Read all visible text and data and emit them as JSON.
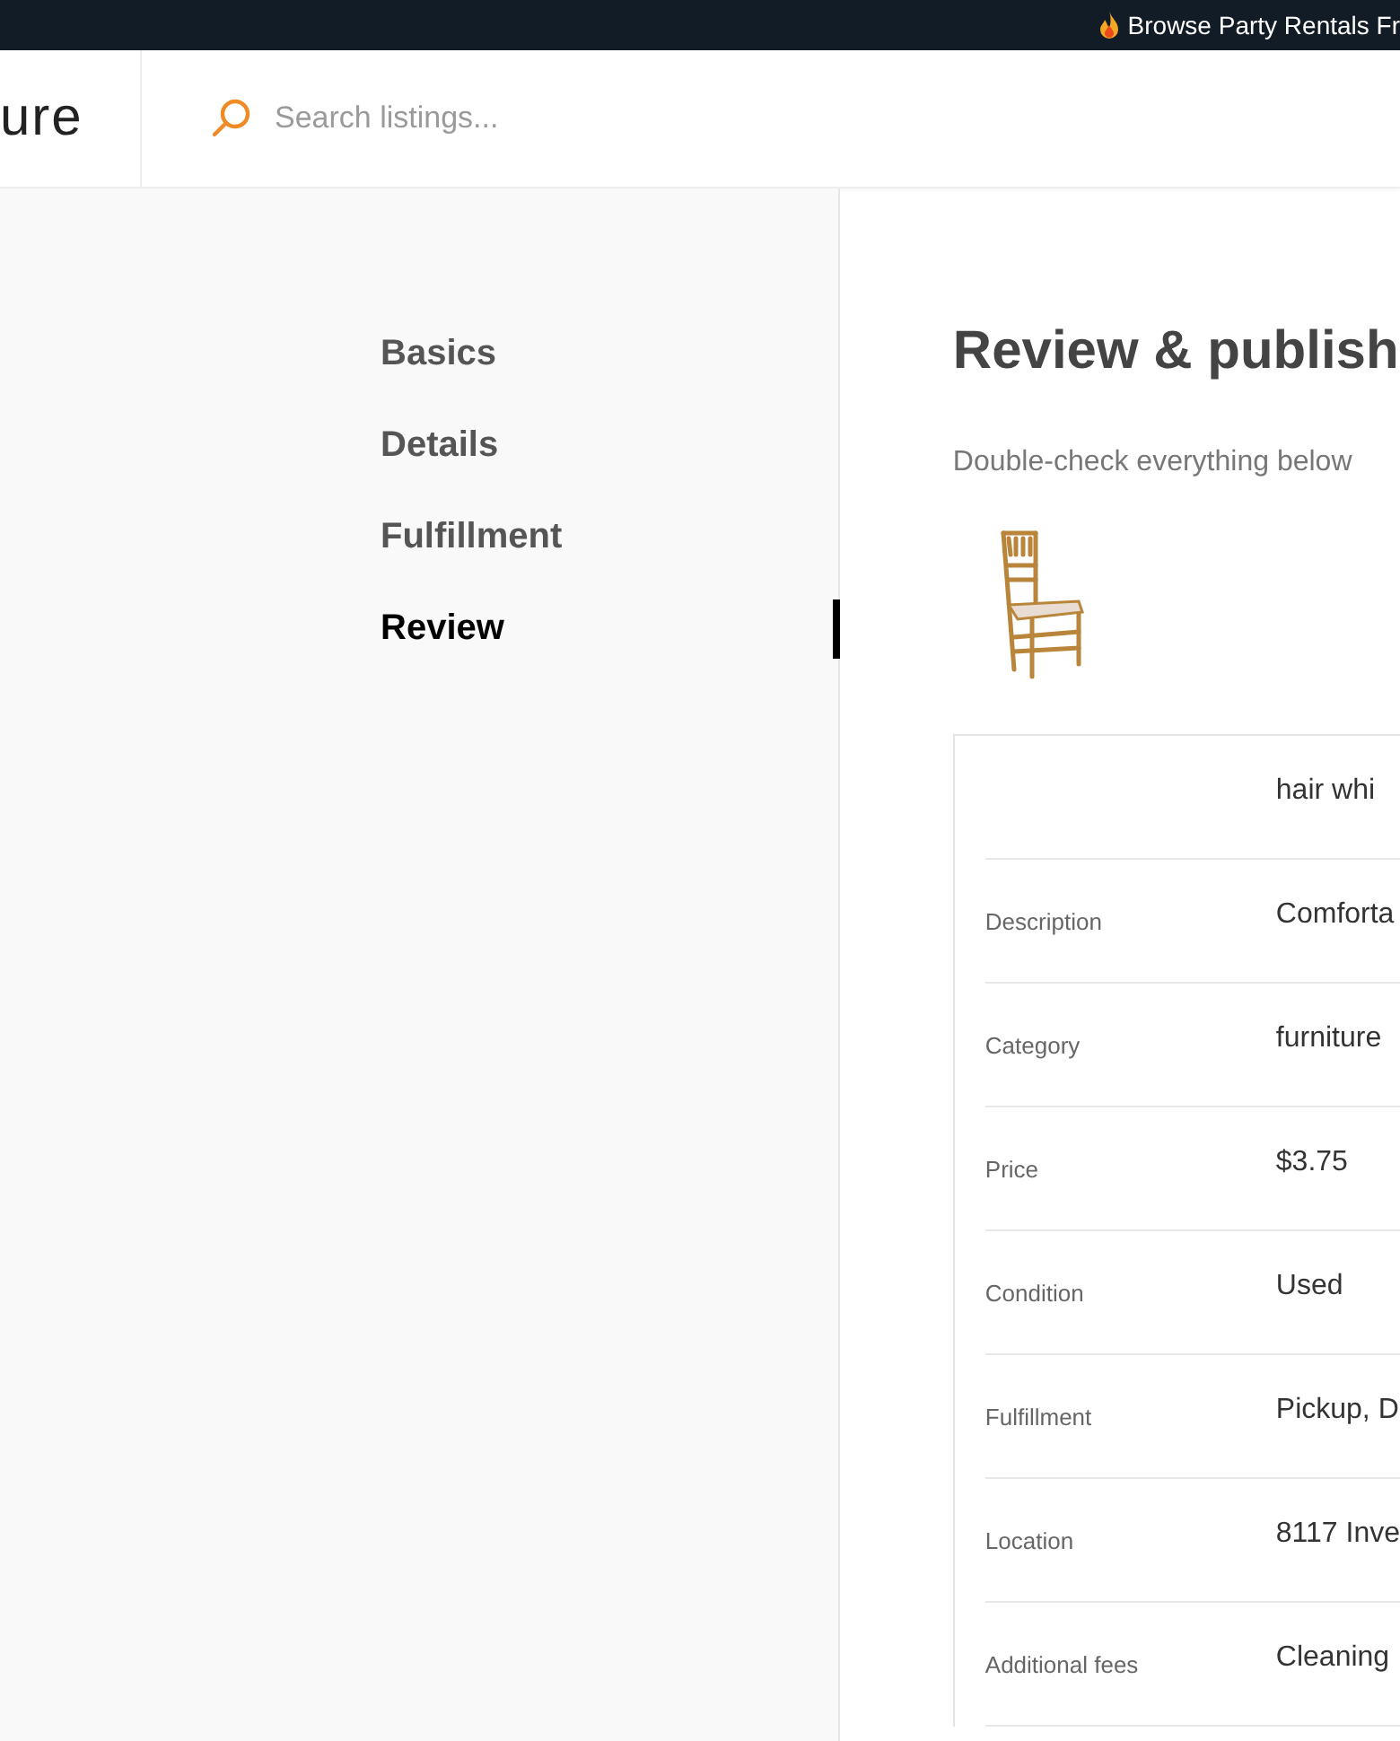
{
  "announcement": {
    "text": "Browse Party Rentals Fr"
  },
  "header": {
    "logo": "ure",
    "search": {
      "placeholder": "Search listings..."
    }
  },
  "steps": [
    {
      "label": "Basics",
      "selected": false
    },
    {
      "label": "Details",
      "selected": false
    },
    {
      "label": "Fulfillment",
      "selected": false
    },
    {
      "label": "Review",
      "selected": true
    }
  ],
  "review": {
    "title": "Review & publish",
    "subtitle": "Double-check everything below",
    "rows": [
      {
        "value": "hair whi"
      },
      {
        "label": "Description",
        "value": "Comforta"
      },
      {
        "label": "Category",
        "value": "furniture"
      },
      {
        "label": "Price",
        "value": "$3.75"
      },
      {
        "label": "Condition",
        "value": "Used"
      },
      {
        "label": "Fulfillment",
        "value": "Pickup, D"
      },
      {
        "label": "Location",
        "value": "8117 Inve"
      },
      {
        "label": "Additional fees",
        "value": "Cleaning"
      }
    ]
  }
}
